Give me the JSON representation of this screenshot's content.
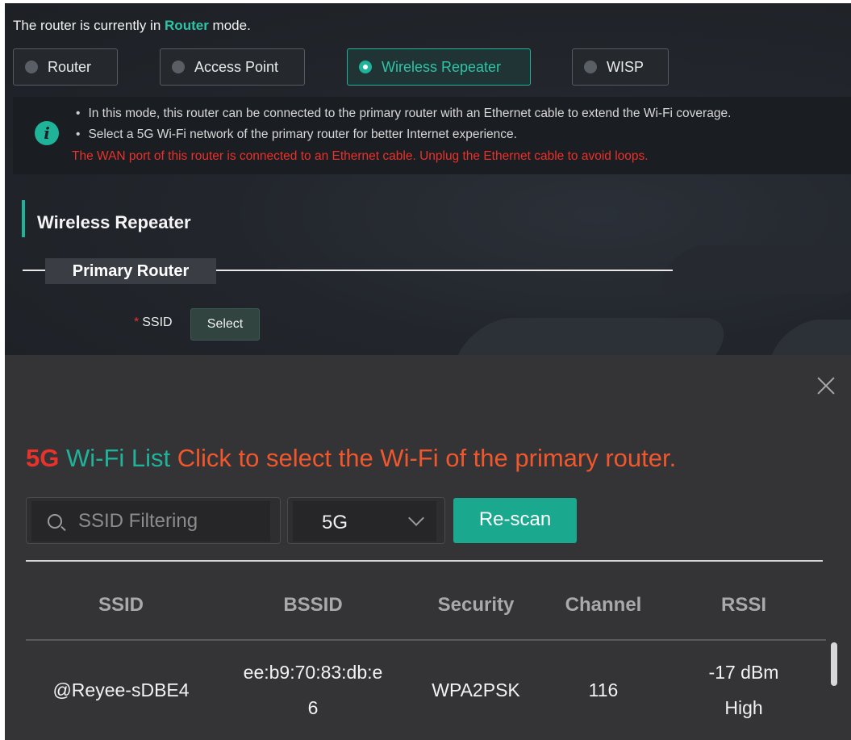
{
  "mode_status": {
    "prefix": "The router is currently in",
    "mode": "Router",
    "suffix": "mode."
  },
  "modes": [
    {
      "label": "Router",
      "selected": false
    },
    {
      "label": "Access Point",
      "selected": false
    },
    {
      "label": "Wireless Repeater",
      "selected": true
    },
    {
      "label": "WISP",
      "selected": false
    }
  ],
  "info": {
    "bullets": [
      "In this mode, this router can be connected to the primary router with an Ethernet cable to extend the Wi-Fi coverage.",
      "Select a 5G Wi-Fi network of the primary router for better Internet experience."
    ],
    "warning": "The WAN port of this router is connected to an Ethernet cable. Unplug the Ethernet cable to avoid loops."
  },
  "section_title": "Wireless Repeater",
  "primary_router_label": "Primary Router",
  "ssid_field": {
    "label": "SSID",
    "required_mark": "*",
    "button": "Select"
  },
  "modal": {
    "title_5g": "5G",
    "title_list": "Wi-Fi List",
    "title_hint": "Click to select the Wi-Fi of the primary router.",
    "search_placeholder": "SSID Filtering",
    "band_value": "5G",
    "rescan_label": "Re-scan",
    "columns": [
      "SSID",
      "BSSID",
      "Security",
      "Channel",
      "RSSI"
    ],
    "rows": [
      {
        "ssid": "@Reyee-sDBE4",
        "bssid_line1": "ee:b9:70:83:db:e",
        "bssid_line2": "6",
        "security": "WPA2PSK",
        "channel": "116",
        "rssi": "-17 dBm",
        "quality": "High"
      }
    ]
  },
  "colors": {
    "accent": "#1fb39a",
    "warning": "#e8322c",
    "title_orange": "#f0572c"
  }
}
